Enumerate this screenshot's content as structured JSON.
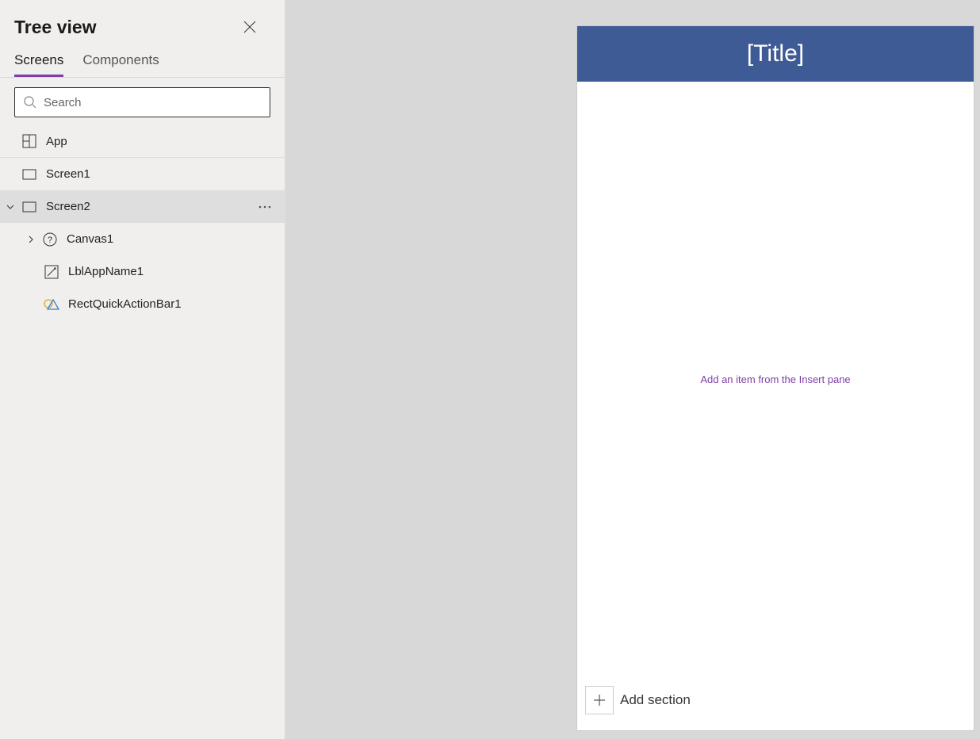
{
  "sidebar": {
    "title": "Tree view",
    "tabs": [
      {
        "label": "Screens",
        "active": true
      },
      {
        "label": "Components",
        "active": false
      }
    ],
    "search": {
      "placeholder": "Search"
    }
  },
  "tree": {
    "app": {
      "label": "App"
    },
    "screen1": {
      "label": "Screen1"
    },
    "screen2": {
      "label": "Screen2"
    },
    "canvas1": {
      "label": "Canvas1"
    },
    "lblAppName1": {
      "label": "LblAppName1"
    },
    "rectQuickActionBar1": {
      "label": "RectQuickActionBar1"
    }
  },
  "canvas": {
    "title": "[Title]",
    "hint": "Add an item from the Insert pane",
    "addSection": "Add section"
  }
}
